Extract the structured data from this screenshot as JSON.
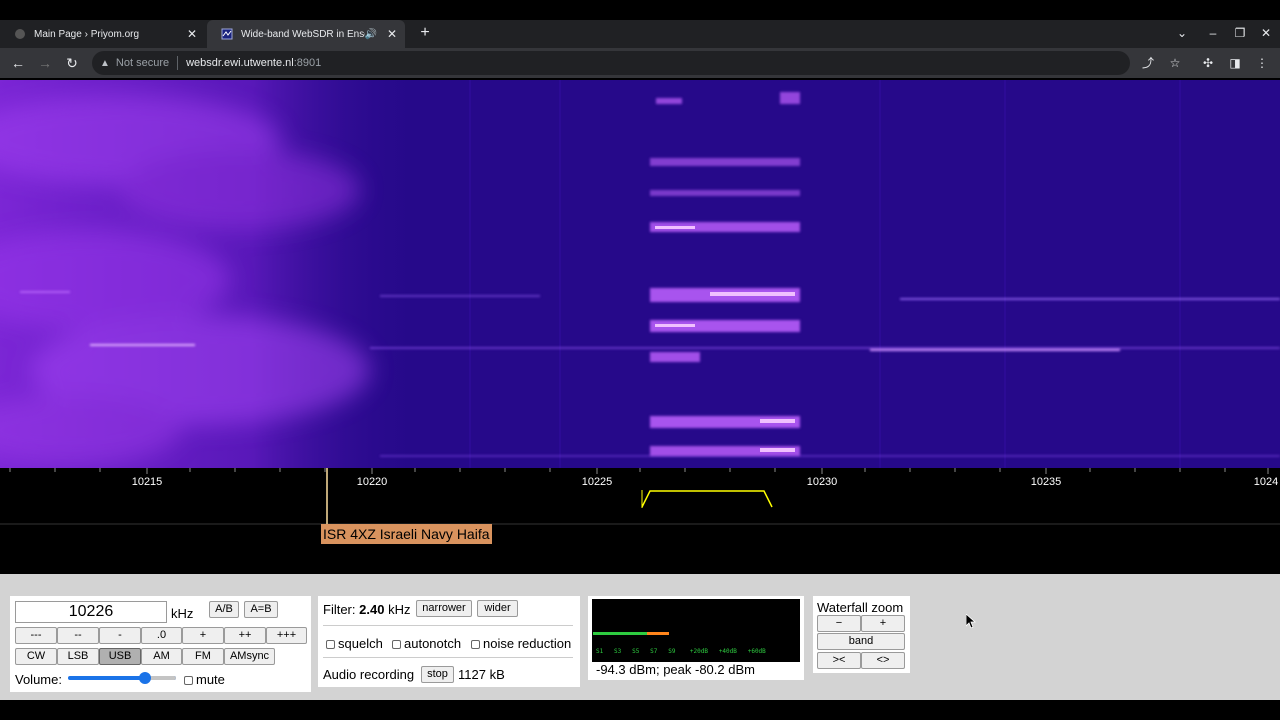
{
  "browser": {
    "tabs": [
      {
        "title": "Main Page › Priyom.org",
        "active": false,
        "favicon": "priyom-icon"
      },
      {
        "title": "Wide-band WebSDR in Ensch",
        "active": true,
        "favicon": "websdr-icon",
        "audio": true
      }
    ],
    "address": {
      "security": "Not secure",
      "host": "websdr.ewi.utwente.nl",
      "port": ":8901"
    }
  },
  "scale": {
    "ticks": [
      "10215",
      "10220",
      "10225",
      "10230",
      "10235",
      "1024"
    ],
    "station_label": "ISR 4XZ Israeli Navy Haifa"
  },
  "tuning": {
    "frequency": "10226",
    "unit": "kHz",
    "ab_label": "A/B",
    "aeqb_label": "A=B",
    "step_buttons": [
      "---",
      "--",
      "-",
      ".0",
      "+",
      "++",
      "+++"
    ],
    "modes": [
      "CW",
      "LSB",
      "USB",
      "AM",
      "FM",
      "AMsync"
    ],
    "active_mode": "USB",
    "volume_label": "Volume:",
    "volume_level": 0.78,
    "mute_label": "mute"
  },
  "filter": {
    "label": "Filter:",
    "value": "2.40",
    "unit": "kHz",
    "narrower": "narrower",
    "wider": "wider",
    "squelch": "squelch",
    "autonotch": "autonotch",
    "noise_reduction": "noise reduction",
    "recording_label": "Audio recording",
    "stop": "stop",
    "size": "1127 kB"
  },
  "smeter": {
    "scale_text": "S1   S3   S5   S7   S9    +20dB   +40dB   +60dB",
    "reading": "-94.3 dBm; peak  -80.2 dBm",
    "level": 0.35,
    "peak": 0.36
  },
  "zoom": {
    "title": "Waterfall zoom",
    "minus": "−",
    "plus": "+",
    "band": "band",
    "narrow": "><",
    "widen": "<>"
  },
  "colors": {
    "waterfall_bg": "#2a0a8f",
    "waterfall_hot": "#b040ff",
    "passband": "#ffff00",
    "station_label_bg": "#d9935e",
    "marker": "#ffe0a0"
  }
}
